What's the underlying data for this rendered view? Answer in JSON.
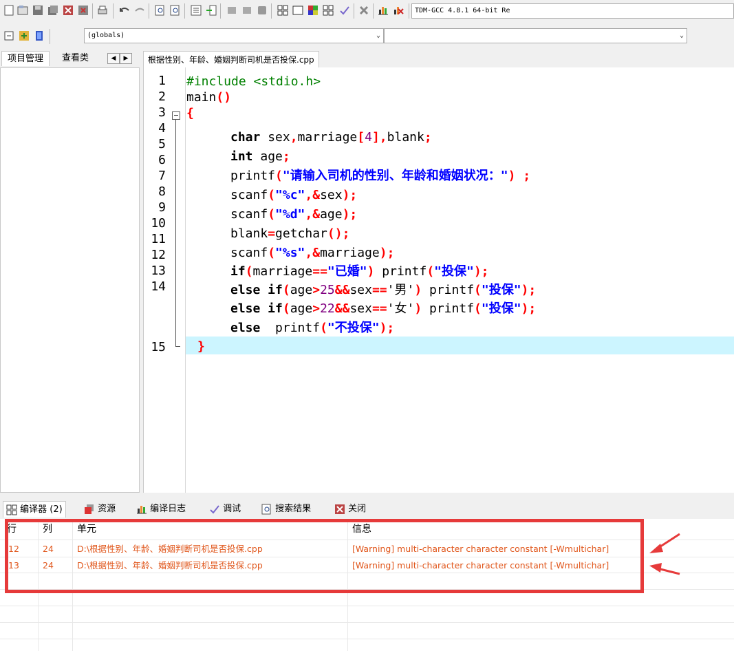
{
  "toolbar": {
    "compiler_select": "TDM-GCC 4.8.1 64-bit Re",
    "globals_select": "(globals)"
  },
  "left_panel": {
    "tab_project": "项目管理",
    "tab_classes": "查看类"
  },
  "editor": {
    "file_tab": "根据性别、年龄、婚姻判断司机是否投保.cpp",
    "line_numbers": [
      "1",
      "2",
      "3",
      "4",
      "5",
      "6",
      "7",
      "8",
      "9",
      "10",
      "11",
      "12",
      "13",
      "14",
      "15"
    ]
  },
  "code": {
    "l1_pp": "#include <stdio.h>",
    "l2_a": "main",
    "l2_b": "()",
    "l3": "{",
    "l4_kw": "char",
    "l4_a": " sex",
    "l4_b": ",",
    "l4_c": "marriage",
    "l4_d": "[",
    "l4_e": "4",
    "l4_f": "],",
    "l4_g": "blank",
    "l4_h": ";",
    "l5_kw": "int",
    "l5_a": " age",
    "l5_b": ";",
    "l6_a": "printf",
    "l6_b": "(",
    "l6_c": "\"请输入司机的性别、年龄和婚姻状况：\"",
    "l6_d": ") ;",
    "l7_a": "scanf",
    "l7_b": "(",
    "l7_c": "\"%c\"",
    "l7_d": ",&",
    "l7_e": "sex",
    "l7_f": ");",
    "l8_a": "scanf",
    "l8_b": "(",
    "l8_c": "\"%d\"",
    "l8_d": ",&",
    "l8_e": "age",
    "l8_f": ");",
    "l9_a": "blank",
    "l9_b": "=",
    "l9_c": "getchar",
    "l9_d": "();",
    "l10_a": "scanf",
    "l10_b": "(",
    "l10_c": "\"%s\"",
    "l10_d": ",&",
    "l10_e": "marriage",
    "l10_f": ");",
    "l11_kw": "if",
    "l11_a": "(",
    "l11_b": "marriage",
    "l11_c": "==",
    "l11_d": "\"已婚\"",
    "l11_e": ")",
    "l11_f": " printf",
    "l11_g": "(",
    "l11_h": "\"投保\"",
    "l11_i": ");",
    "l12_kw": "else if",
    "l12_a": "(",
    "l12_b": "age",
    "l12_c": ">",
    "l12_d": "25",
    "l12_e": "&&",
    "l12_f": "sex",
    "l12_g": "==",
    "l12_h": "'男'",
    "l12_i": ")",
    "l12_j": " printf",
    "l12_k": "(",
    "l12_l": "\"投保\"",
    "l12_m": ");",
    "l13_kw": "else if",
    "l13_a": "(",
    "l13_b": "age",
    "l13_c": ">",
    "l13_d": "22",
    "l13_e": "&&",
    "l13_f": "sex",
    "l13_g": "==",
    "l13_h": "'女'",
    "l13_i": ")",
    "l13_j": " printf",
    "l13_k": "(",
    "l13_l": "\"投保\"",
    "l13_m": ");",
    "l14_kw": "else",
    "l14_a": "  printf",
    "l14_b": "(",
    "l14_c": "\"不投保\"",
    "l14_d": ");",
    "l15": "}"
  },
  "bottom_tabs": {
    "compiler": "编译器 (2)",
    "resources": "资源",
    "compile_log": "编译日志",
    "debug": "调试",
    "search_results": "搜索结果",
    "close": "关闭"
  },
  "messages": {
    "headers": [
      "行",
      "列",
      "单元",
      "信息"
    ],
    "rows": [
      {
        "line": "12",
        "col": "24",
        "unit": "D:\\根据性别、年龄、婚姻判断司机是否投保.cpp",
        "message": "[Warning] multi-character character constant [-Wmultichar]"
      },
      {
        "line": "13",
        "col": "24",
        "unit": "D:\\根据性别、年龄、婚姻判断司机是否投保.cpp",
        "message": "[Warning] multi-character character constant [-Wmultichar]"
      }
    ]
  },
  "colors": {
    "annotation_red": "#e63a3a",
    "warning_text": "#e0561b",
    "current_line": "#ccf5ff"
  }
}
